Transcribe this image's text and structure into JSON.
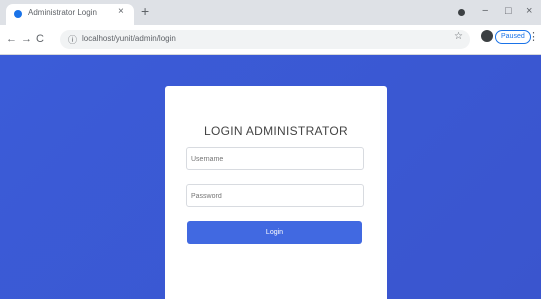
{
  "browser": {
    "tab_title": "Administrator Login",
    "tab_close": "×",
    "new_tab": "+",
    "back": "←",
    "forward": "→",
    "reload": "C",
    "url": "localhost/yunit/admin/login",
    "profile_status": "Paused",
    "menu": "⋮",
    "win_minimize": "−",
    "win_maximize": "□",
    "win_close": "×",
    "star": "☆"
  },
  "login": {
    "title": "LOGIN ADMINISTRATOR",
    "username_placeholder": "Username",
    "password_placeholder": "Password",
    "button_label": "Login"
  },
  "colors": {
    "background": "#3b5cd8",
    "button": "#4169e1"
  }
}
